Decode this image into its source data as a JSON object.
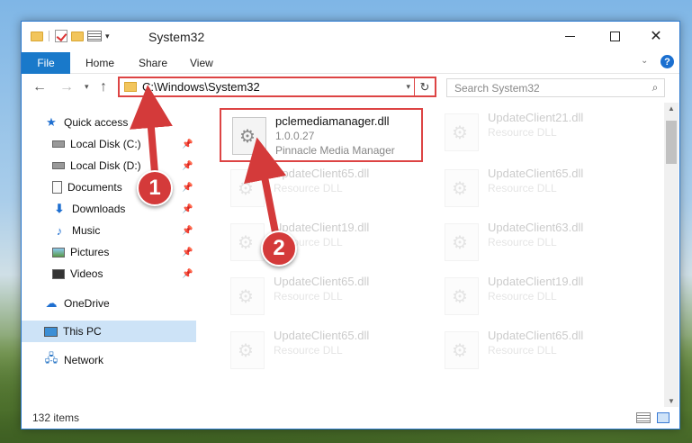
{
  "window": {
    "title": "System32"
  },
  "ribbon": {
    "file": "File",
    "home": "Home",
    "share": "Share",
    "view": "View",
    "help": "?"
  },
  "nav": {
    "address": "C:\\Windows\\System32",
    "search_placeholder": "Search System32"
  },
  "sidebar": {
    "items": [
      {
        "label": "Quick access",
        "icon": "star-icon"
      },
      {
        "label": "Local Disk (C:)",
        "icon": "drive-icon",
        "pinned": true
      },
      {
        "label": "Local Disk (D:)",
        "icon": "drive-icon",
        "pinned": true
      },
      {
        "label": "Documents",
        "icon": "documents-icon",
        "pinned": true
      },
      {
        "label": "Downloads",
        "icon": "download-icon",
        "pinned": true
      },
      {
        "label": "Music",
        "icon": "music-icon",
        "pinned": true
      },
      {
        "label": "Pictures",
        "icon": "pictures-icon",
        "pinned": true
      },
      {
        "label": "Videos",
        "icon": "videos-icon",
        "pinned": true
      },
      {
        "label": "OneDrive",
        "icon": "cloud-icon"
      },
      {
        "label": "This PC",
        "icon": "computer-icon",
        "selected": true
      },
      {
        "label": "Network",
        "icon": "network-icon"
      }
    ]
  },
  "files": {
    "highlighted": {
      "name": "pclemediamanager.dll",
      "version": "1.0.0.27",
      "description": "Pinnacle Media Manager"
    },
    "ghost": [
      {
        "name": "UpdateClient21.dll",
        "type": "Resource DLL"
      },
      {
        "name": "UpdateClient65.dll",
        "type": "Resource DLL"
      },
      {
        "name": "UpdateClient65.dll",
        "type": "Resource DLL"
      },
      {
        "name": "UpdateClient19.dll",
        "type": "Resource DLL"
      },
      {
        "name": "UpdateClient63.dll",
        "type": "Resource DLL"
      },
      {
        "name": "UpdateClient65.dll",
        "type": "Resource DLL"
      },
      {
        "name": "UpdateClient19.dll",
        "type": "Resource DLL"
      },
      {
        "name": "UpdateClient65.dll",
        "type": "Resource DLL"
      },
      {
        "name": "UpdateClient65.dll",
        "type": "Resource DLL"
      }
    ]
  },
  "status": {
    "count": "132 items"
  },
  "annotations": {
    "step1": "1",
    "step2": "2",
    "color": "#d43a3a"
  }
}
